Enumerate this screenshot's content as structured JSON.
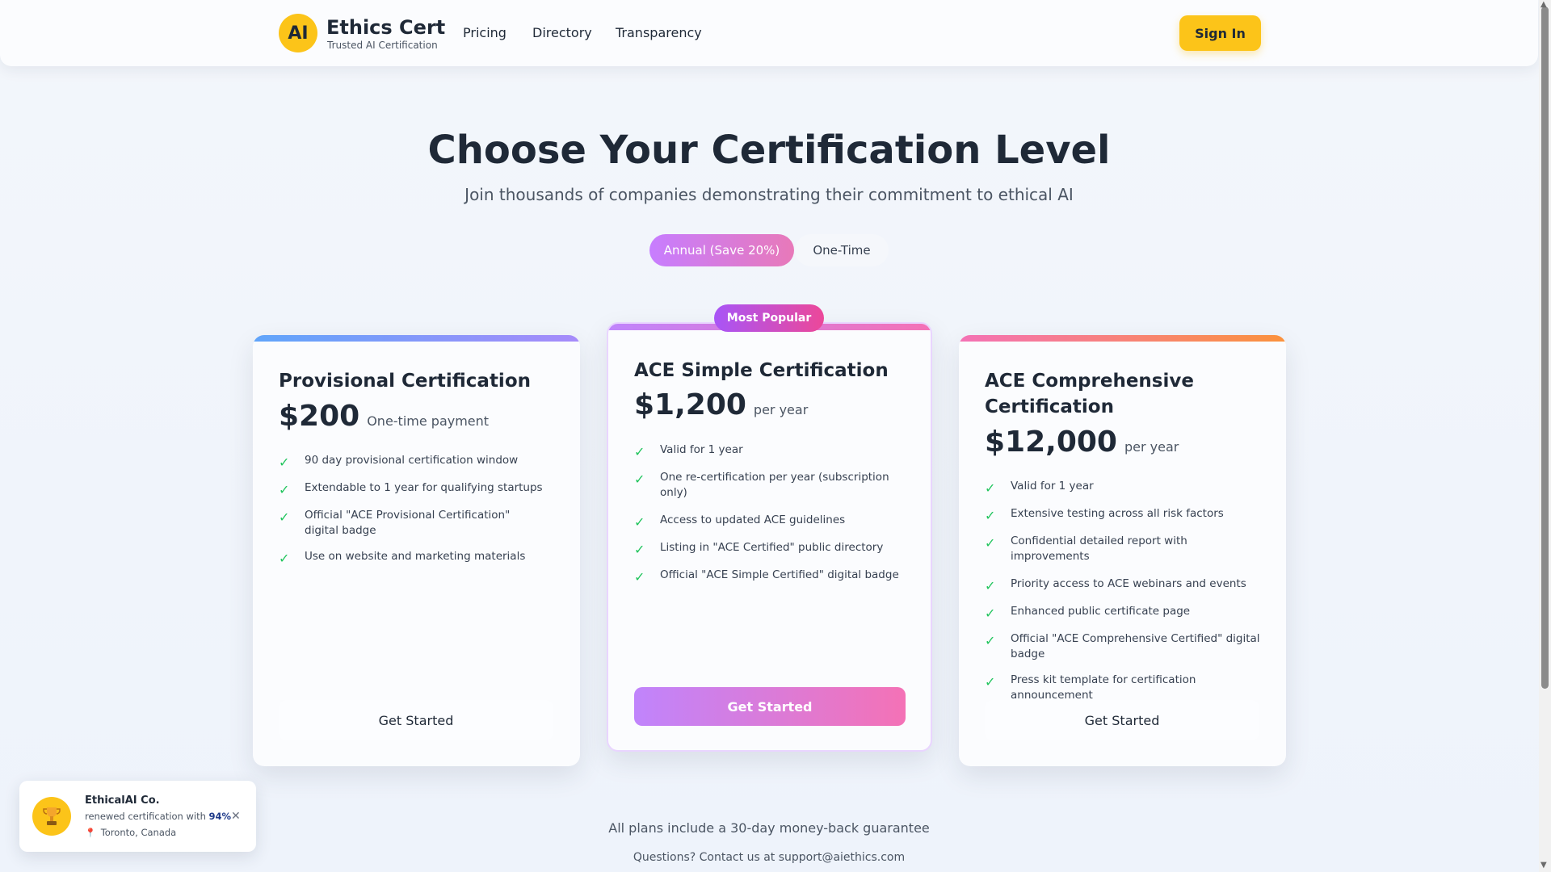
{
  "header": {
    "logo_text": "AI",
    "brand_title": "Ethics Cert",
    "brand_subtitle": "Trusted AI Certification",
    "nav": [
      "Pricing",
      "Directory",
      "Transparency"
    ],
    "signin_label": "Sign In"
  },
  "hero": {
    "title": "Choose Your Certification Level",
    "subtitle": "Join thousands of companies demonstrating their commitment to ethical AI",
    "toggle": {
      "annual_label": "Annual (Save 20%)",
      "onetime_label": "One-Time",
      "selected": "annual"
    }
  },
  "badge_popular": "Most Popular",
  "plans": [
    {
      "title": "Provisional Certification",
      "price": "$200",
      "price_suffix": "One-time payment",
      "features": [
        "90 day provisional certification window",
        "Extendable to 1 year for qualifying startups",
        "Official \"ACE Provisional Certification\" digital badge",
        "Use on website and marketing materials"
      ],
      "cta": "Get Started"
    },
    {
      "title": "ACE Simple Certification",
      "price": "$1,200",
      "price_suffix": "per year",
      "features": [
        "Valid for 1 year",
        "One re-certification per year (subscription only)",
        "Access to updated ACE guidelines",
        "Listing in \"ACE Certified\" public directory",
        "Official \"ACE Simple Certified\" digital badge"
      ],
      "cta": "Get Started"
    },
    {
      "title_line1": "ACE Comprehensive",
      "title_line2": "Certification",
      "price": "$12,000",
      "price_suffix": "per year",
      "features": [
        "Valid for 1 year",
        "Extensive testing across all risk factors",
        "Confidential detailed report with improvements",
        "Priority access to ACE webinars and events",
        "Enhanced public certificate page",
        "Official \"ACE Comprehensive Certified\" digital badge",
        "Press kit template for certification announcement"
      ],
      "cta": "Get Started"
    }
  ],
  "footer": {
    "guarantee": "All plans include a 30-day money-back guarantee",
    "contact": "Questions? Contact us at support@aiethics.com"
  },
  "toast": {
    "company": "EthicalAI Co.",
    "message_prefix": "renewed certification with ",
    "score": "94%",
    "location": "Toronto, Canada",
    "avatar_icon": "trophy-icon",
    "pin_icon": "pin-icon",
    "close_icon": "close-icon"
  },
  "colors": {
    "accent_yellow": "#fcc419",
    "gradient_purple": "#c084fc",
    "gradient_pink": "#f472b6",
    "check_green": "#22c55e"
  }
}
